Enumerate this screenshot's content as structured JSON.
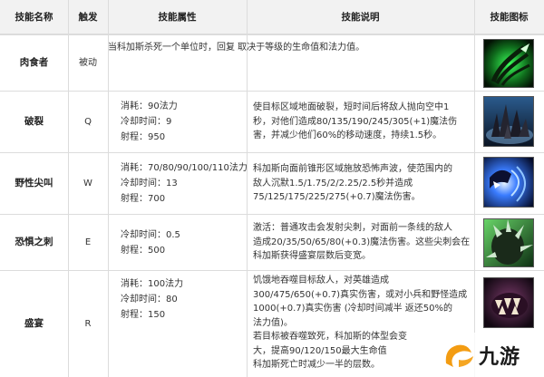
{
  "headers": {
    "name": "技能名称",
    "trigger": "触发",
    "attributes": "技能属性",
    "description": "技能说明",
    "icon": "技能图标"
  },
  "rows": [
    {
      "name": "肉食者",
      "trigger": "被动",
      "attributes": [],
      "description": [
        "当科加斯杀死一个单位时，回复 取决于等级的生命值和法力值。"
      ],
      "icon": "passive-talon-icon"
    },
    {
      "name": "破裂",
      "trigger": "Q",
      "attributes": [
        "消耗：90法力",
        "冷却时间：9",
        "射程：950"
      ],
      "description": [
        "使目标区域地面破裂，短时间后将敌人抛向空中1",
        "秒，对他们造成80/135/190/245/305(+1)魔法伤",
        "害，并减少他们60%的移动速度，持续1.5秒。"
      ],
      "icon": "rupture-spikes-icon"
    },
    {
      "name": "野性尖叫",
      "trigger": "W",
      "attributes": [
        "消耗：70/80/90/100/110法力",
        "冷却时间：13",
        "射程：700"
      ],
      "description": [
        "科加斯向面前锥形区域施放恐怖声波，使范围内的",
        "敌人沉默1.5/1.75/2/2.25/2.5秒并造成",
        "75/125/175/225/275(+0.7)魔法伤害。"
      ],
      "icon": "scream-wave-icon"
    },
    {
      "name": "恐惧之刺",
      "trigger": "E",
      "attributes": [
        "冷却时间：0.5",
        "射程：500"
      ],
      "description": [
        "激活：普通攻击会发射尖刺，对面前一条线的敌人",
        "造成20/35/50/65/80(+0.3)魔法伤害。这些尖刺会在",
        "科加斯获得盛宴层数后变宽。"
      ],
      "icon": "spike-shell-icon"
    },
    {
      "name": "盛宴",
      "trigger": "R",
      "attributes": [
        "消耗：100法力",
        "冷却时间：80",
        "射程：150"
      ],
      "description": [
        "饥饿地吞噬目标敌人，对英雄造成",
        "300/475/650(+0.7)真实伤害，或对小兵和野怪造成",
        "1000(+0.7)真实伤害 (冷却时间减半 返还50%的",
        "法力值)。",
        "    若目标被吞噬致死，科加斯的体型会变",
        "大，提高90/120/150最大生命值",
        "科加斯死亡时减少一半的层数。"
      ],
      "icon": "feast-maw-icon"
    }
  ],
  "watermark": {
    "logo_text": "九游"
  },
  "colors": {
    "header_bg": "#f2f2f2",
    "grid": "#dcdcdc",
    "wm_orange": "#f39c12"
  }
}
